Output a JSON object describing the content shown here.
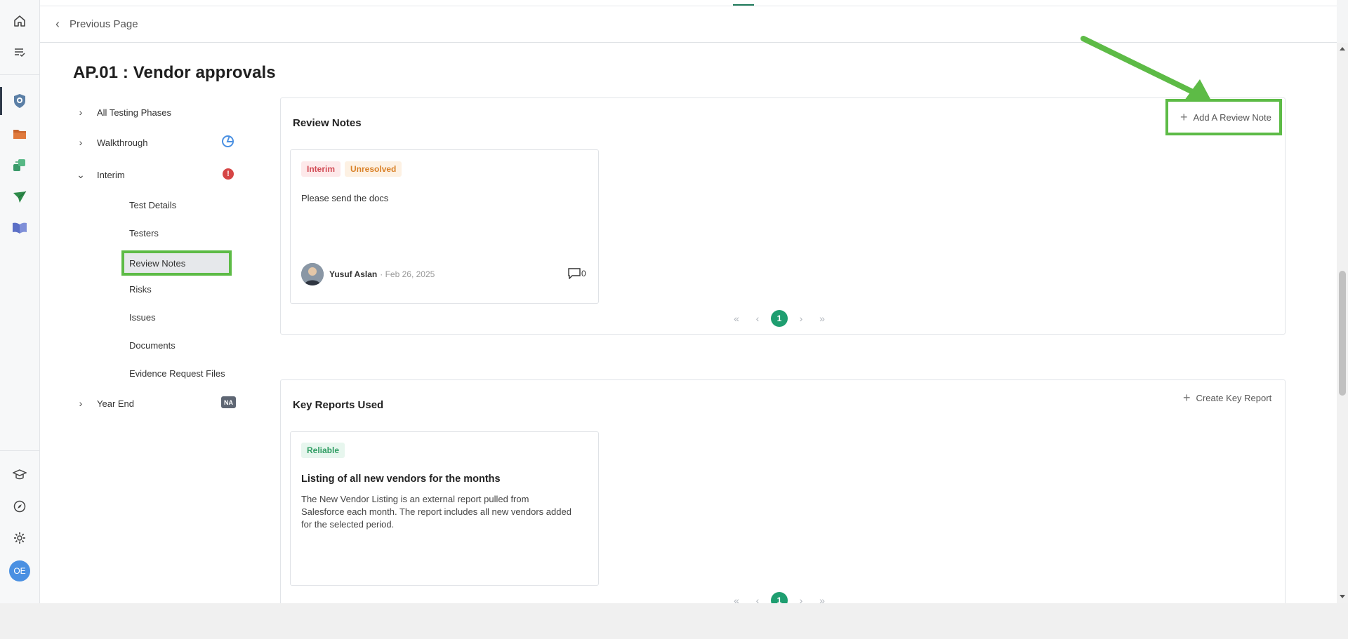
{
  "topbar": {
    "back_label": "Previous Page"
  },
  "page": {
    "title": "AP.01 : Vendor approvals"
  },
  "tree": {
    "phases": [
      {
        "label": "All Testing Phases"
      },
      {
        "label": "Walkthrough"
      },
      {
        "label": "Interim"
      },
      {
        "label": "Year End",
        "badge": "NA"
      }
    ],
    "interim_children": [
      "Test Details",
      "Testers",
      "Review Notes",
      "Risks",
      "Issues",
      "Documents",
      "Evidence Request Files"
    ]
  },
  "review_notes": {
    "title": "Review Notes",
    "action": "Add A Review Note",
    "cards": [
      {
        "tags": [
          "Interim",
          "Unresolved"
        ],
        "text": "Please send the docs",
        "author": "Yusuf Aslan",
        "date": "· Feb 26, 2025",
        "comments": "0"
      }
    ],
    "page": "1"
  },
  "key_reports": {
    "title": "Key Reports Used",
    "action": "Create Key Report",
    "cards": [
      {
        "tag": "Reliable",
        "title": "Listing of all new vendors for the months",
        "description": "The New Vendor Listing is an external report pulled from Salesforce each month. The report includes all new vendors added for the selected period."
      }
    ],
    "page": "1"
  },
  "user": {
    "initials": "OE"
  },
  "colors": {
    "accent_green": "#1e9e70",
    "highlight": "#5dbb46",
    "alert_red": "#d64545",
    "progress_blue": "#4a90e2"
  },
  "icons": [
    "home-icon",
    "list-check-icon",
    "shield-icon",
    "folder-icon",
    "sync-icon",
    "send-icon",
    "book-icon",
    "graduation-cap-icon",
    "compass-icon",
    "gear-icon"
  ]
}
